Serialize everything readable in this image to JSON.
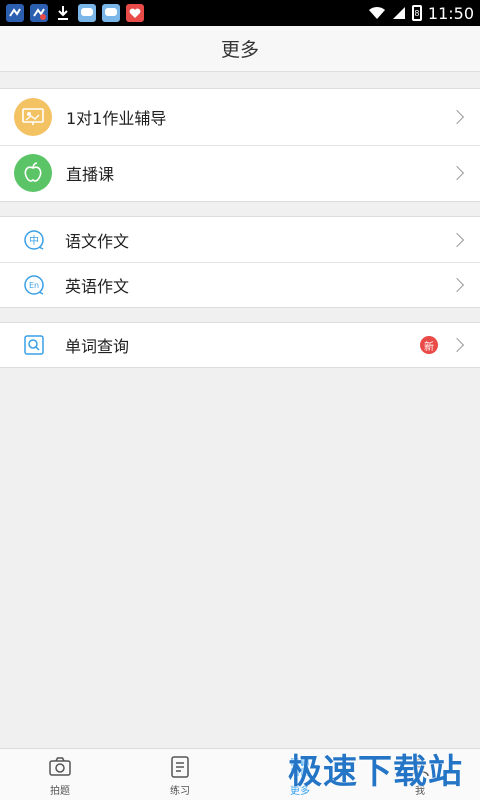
{
  "status_bar": {
    "time": "11:50",
    "battery_level": "8"
  },
  "header": {
    "title": "更多"
  },
  "groups": [
    {
      "items": [
        {
          "label": "1对1作业辅导",
          "icon": "whiteboard-icon"
        },
        {
          "label": "直播课",
          "icon": "apple-icon"
        }
      ]
    },
    {
      "items": [
        {
          "label": "语文作文",
          "icon": "chinese-icon",
          "glyph": "中"
        },
        {
          "label": "英语作文",
          "icon": "english-icon",
          "glyph": "En"
        }
      ]
    },
    {
      "items": [
        {
          "label": "单词查询",
          "icon": "search-book-icon",
          "badge": "新"
        }
      ]
    }
  ],
  "bottom_nav": {
    "items": [
      {
        "label": "拍题",
        "icon": "camera-icon",
        "active": false
      },
      {
        "label": "练习",
        "icon": "notes-icon",
        "active": false
      },
      {
        "label": "更多",
        "icon": "more-icon",
        "active": true
      },
      {
        "label": "我",
        "icon": "user-icon",
        "active": false
      }
    ]
  },
  "watermark": "极速下载站",
  "colors": {
    "accent": "#2e9ff0",
    "badge": "#e94b48",
    "tutor_icon_bg": "#f3c262",
    "live_icon_bg": "#5bc466"
  }
}
